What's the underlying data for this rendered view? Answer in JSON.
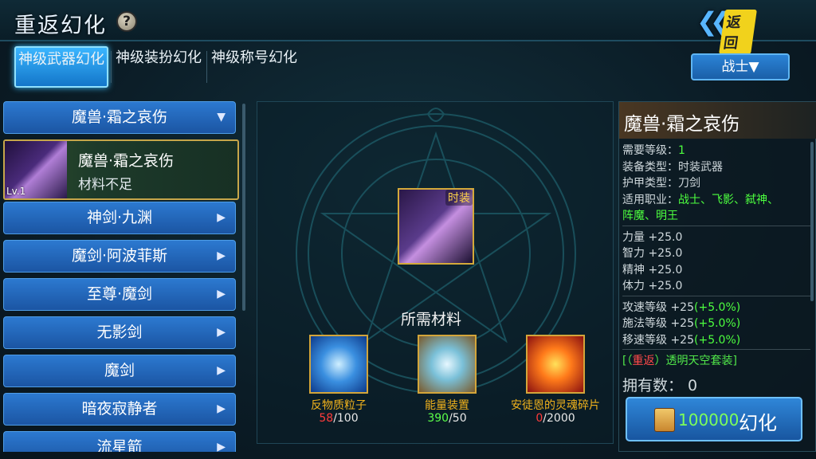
{
  "header": {
    "title": "重返幻化",
    "help_icon": "?",
    "back_label": "返回"
  },
  "tabs": [
    {
      "label": "神级武器幻化",
      "active": true
    },
    {
      "label": "神级装扮幻化",
      "active": false
    },
    {
      "label": "神级称号幻化",
      "active": false
    }
  ],
  "class_selector": "战士▼",
  "category": {
    "label": "魔兽·霜之哀伤"
  },
  "selected": {
    "name": "魔兽·霜之哀伤",
    "status": "材料不足",
    "level": "Lv.1"
  },
  "list_items": [
    {
      "label": "神剑·九渊"
    },
    {
      "label": "魔剑·阿波菲斯"
    },
    {
      "label": "至尊·魔剑"
    },
    {
      "label": "无影剑"
    },
    {
      "label": "魔剑"
    },
    {
      "label": "暗夜寂静者"
    },
    {
      "label": "流星箭"
    }
  ],
  "preview": {
    "badge": "时装"
  },
  "materials_title": "所需材料",
  "materials": [
    {
      "name": "反物质粒子",
      "have": "58",
      "need": "/100",
      "sufficient": false,
      "icon": "crystal-icon"
    },
    {
      "name": "能量装置",
      "have": "390",
      "need": "/50",
      "sufficient": true,
      "icon": "canister-icon"
    },
    {
      "name": "安徒恩的灵魂碎片",
      "have": "0",
      "need": "/2000",
      "sufficient": false,
      "icon": "soul-fragment-icon"
    }
  ],
  "detail": {
    "title": "魔兽·霜之哀伤",
    "req_level_label": "需要等级：",
    "req_level": "1",
    "equip_type_label": "装备类型：",
    "equip_type": "时装武器",
    "armor_type_label": "护甲类型：",
    "armor_type": "刀剑",
    "jobs_label": "适用职业：",
    "jobs_line1": "战士、飞影、弑神、",
    "jobs_line2": "阵魔、明王",
    "stats": [
      "力量 +25.0",
      "智力 +25.0",
      "精神 +25.0",
      "体力 +25.0"
    ],
    "speed_stats": [
      {
        "label": "攻速等级 +25",
        "pct": "(+5.0%)"
      },
      {
        "label": "施法等级 +25",
        "pct": "(+5.0%)"
      },
      {
        "label": "移速等级 +25",
        "pct": "(+5.0%)"
      }
    ],
    "suit_open": "[（",
    "suit_tag": "重返",
    "suit_close": "）透明天空套装]",
    "owned": "拥有数：  0"
  },
  "action": {
    "cost": "100000",
    "label": "幻化"
  }
}
